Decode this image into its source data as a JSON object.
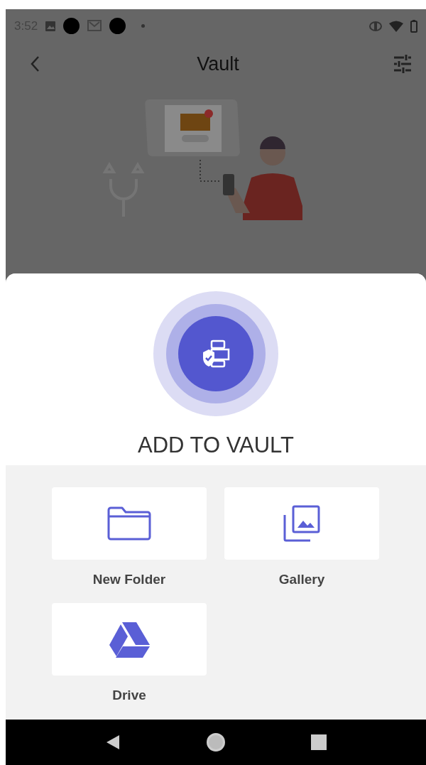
{
  "status_bar": {
    "time": "3:52"
  },
  "app_bar": {
    "title": "Vault"
  },
  "sheet": {
    "title": "ADD TO VAULT",
    "options": [
      {
        "kind": "folder",
        "label": "New Folder"
      },
      {
        "kind": "gallery",
        "label": "Gallery"
      },
      {
        "kind": "drive",
        "label": "Drive"
      }
    ]
  }
}
